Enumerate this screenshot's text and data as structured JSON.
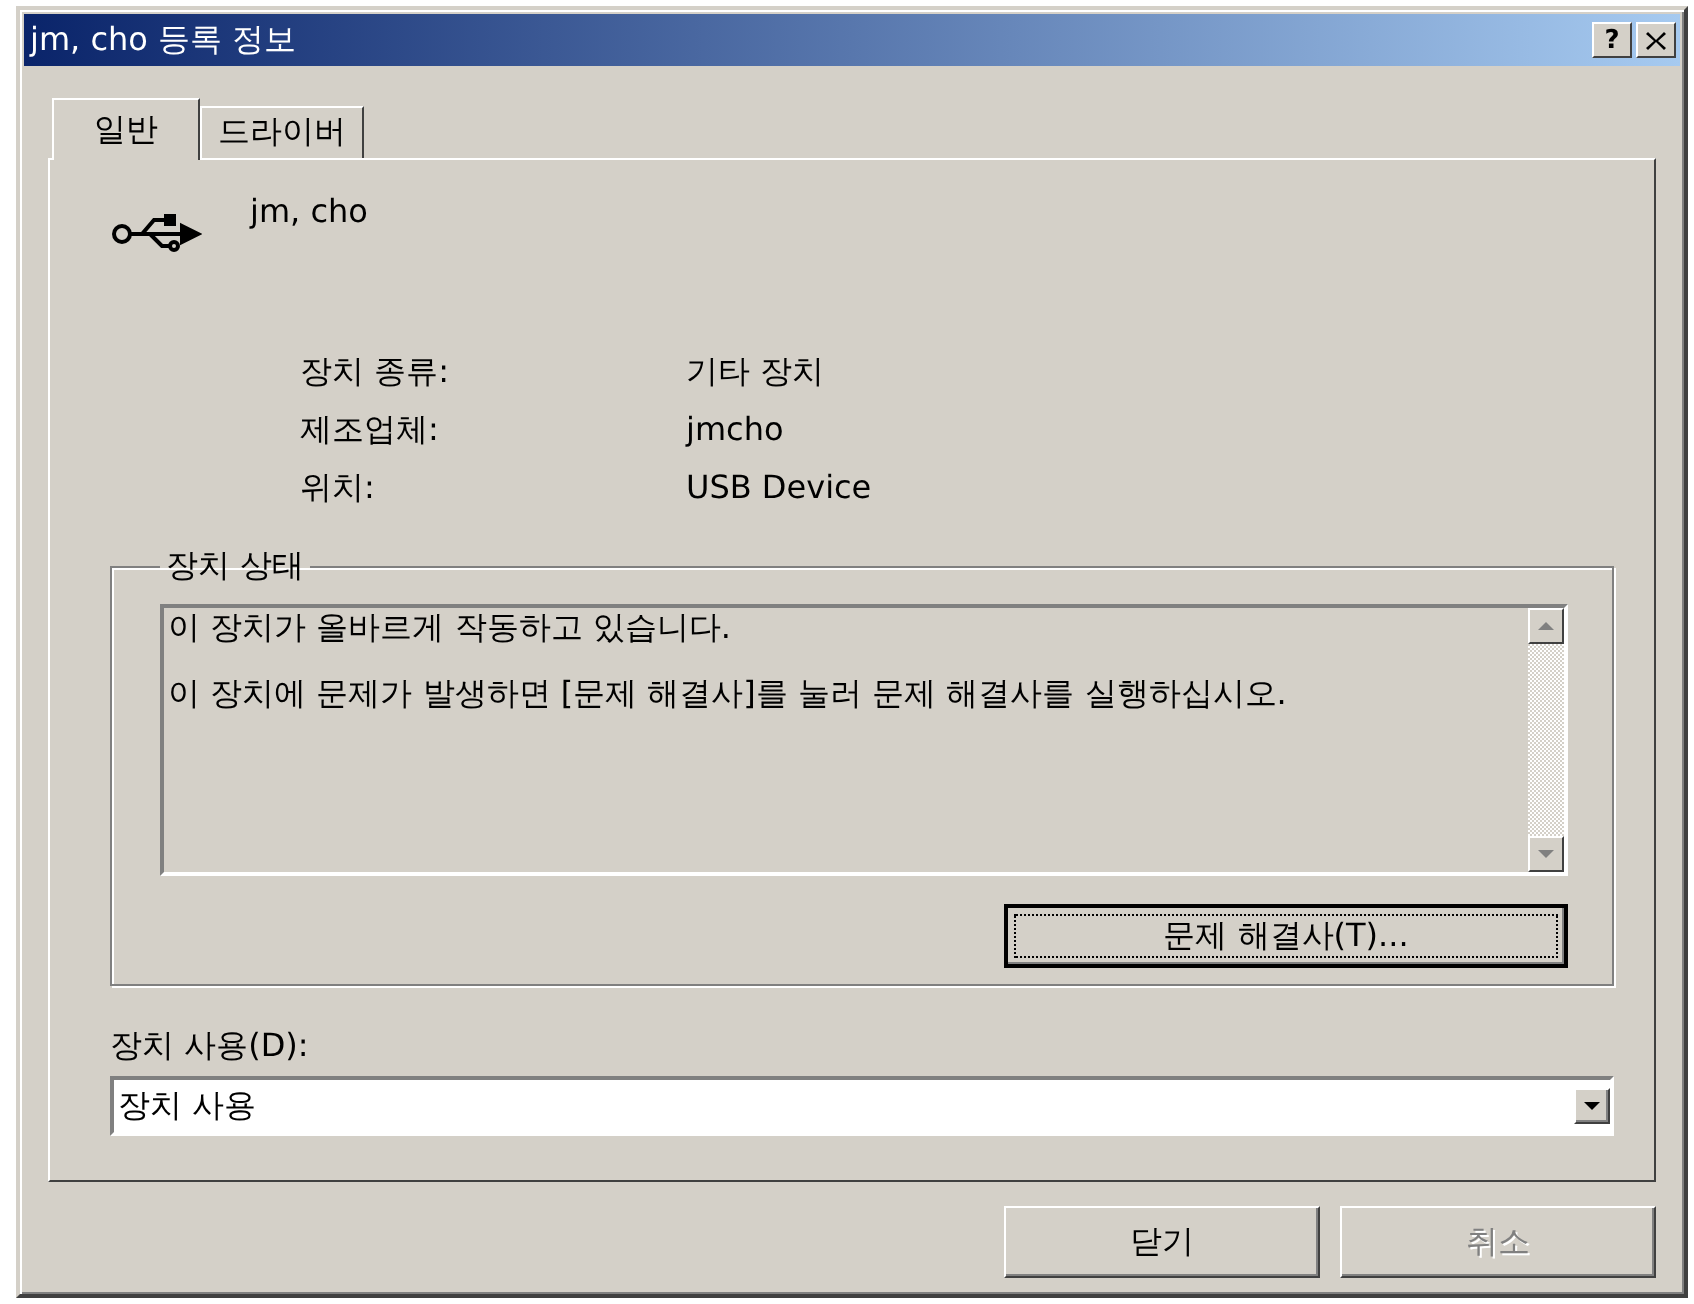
{
  "window": {
    "title": "jm, cho 등록 정보",
    "help_button": "?"
  },
  "tabs": [
    {
      "label": "일반",
      "selected": true
    },
    {
      "label": "드라이버",
      "selected": false
    }
  ],
  "device": {
    "name": "jm, cho"
  },
  "properties": [
    {
      "label": "장치 종류:",
      "value": "기타 장치"
    },
    {
      "label": "제조업체:",
      "value": "jmcho"
    },
    {
      "label": "위치:",
      "value": "USB Device"
    }
  ],
  "status": {
    "legend": "장치 상태",
    "paragraphs": [
      "이 장치가 올바르게 작동하고 있습니다.",
      "이 장치에 문제가 발생하면 [문제 해결사]를 눌러 문제 해결사를 실행하십시오."
    ],
    "troubleshoot_button": "문제 해결사(T)..."
  },
  "usage": {
    "label": "장치 사용(D):",
    "value": "장치 사용"
  },
  "buttons": [
    {
      "label": "닫기",
      "disabled": false
    },
    {
      "label": "취소",
      "disabled": true
    }
  ]
}
